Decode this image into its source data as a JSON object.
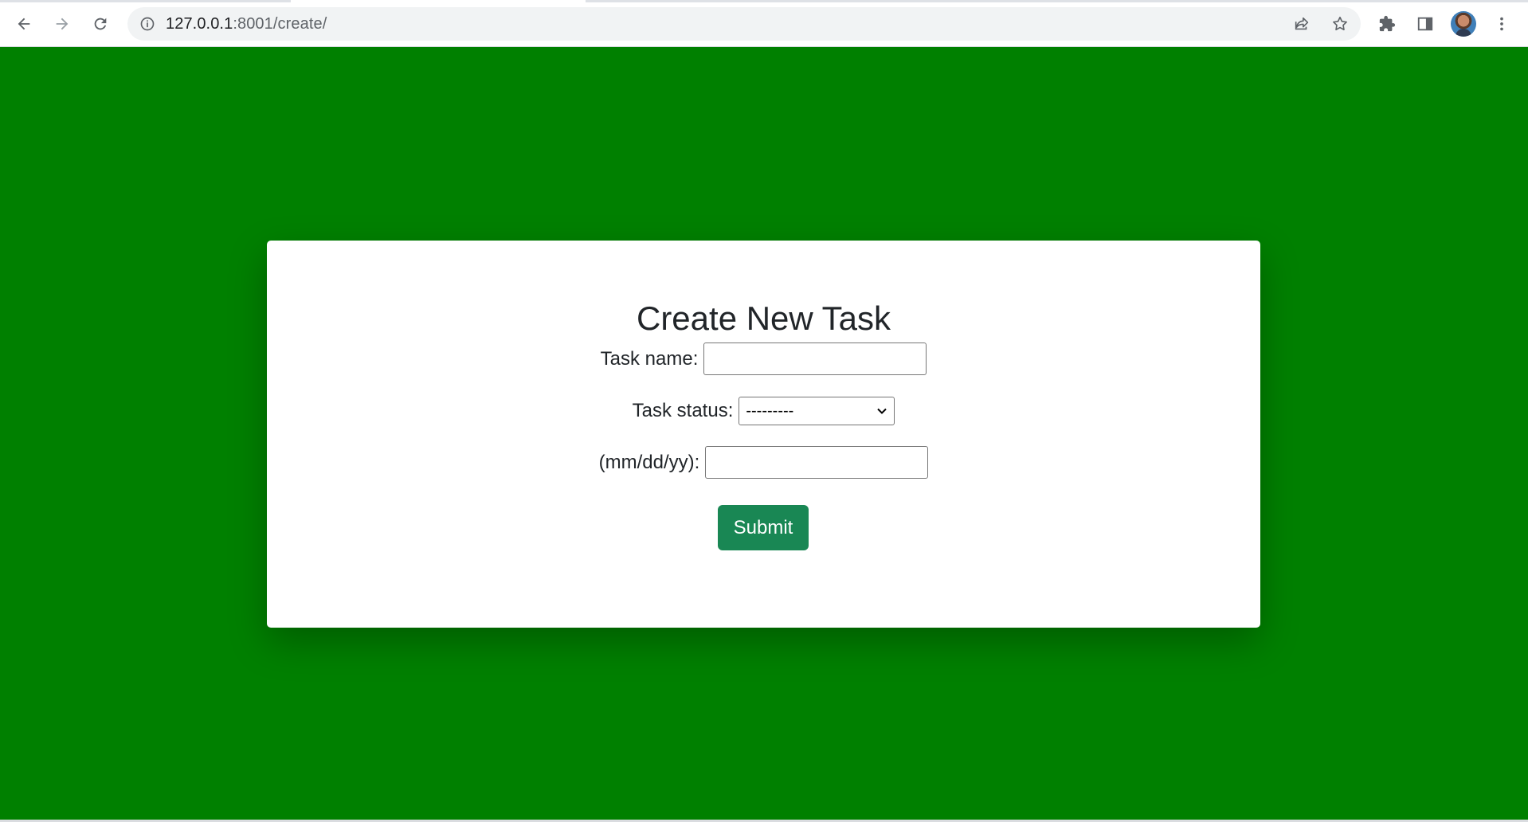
{
  "browser": {
    "url_host": "127.0.0.1",
    "url_path": ":8001/create/"
  },
  "page": {
    "background_color": "#008000",
    "card_color": "#ffffff",
    "accent_color": "#198754"
  },
  "form": {
    "title": "Create New Task",
    "task_name_label": "Task name:",
    "task_name_value": "",
    "task_status_label": "Task status:",
    "task_status_selected": "---------",
    "date_label": "(mm/dd/yy):",
    "date_value": "",
    "submit_label": "Submit"
  },
  "icons": {
    "back": "back-arrow-icon",
    "forward": "forward-arrow-icon",
    "reload": "reload-icon",
    "site_info": "info-icon",
    "share": "share-icon",
    "bookmark": "star-icon",
    "extensions": "puzzle-icon",
    "side_panel": "side-panel-icon",
    "profile": "avatar",
    "menu": "kebab-menu-icon"
  }
}
